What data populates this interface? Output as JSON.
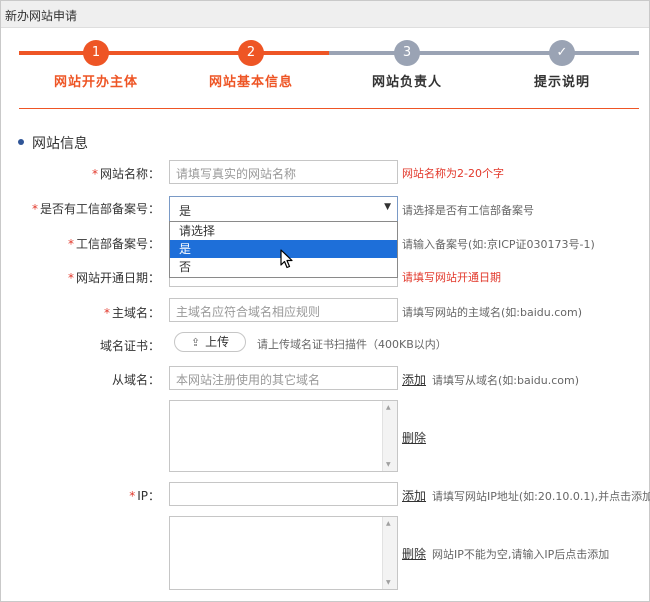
{
  "window": {
    "title": "新办网站申请"
  },
  "steps": [
    {
      "number": "1",
      "label": "网站开办主体",
      "state": "done"
    },
    {
      "number": "2",
      "label": "网站基本信息",
      "state": "active"
    },
    {
      "number": "3",
      "label": "网站负责人",
      "state": "pending"
    },
    {
      "number": "✓",
      "label": "提示说明",
      "state": "pending"
    }
  ],
  "section": {
    "title": "网站信息"
  },
  "form": {
    "site_name": {
      "required": "*",
      "label": "网站名称：",
      "placeholder": "请填写真实的网站名称",
      "hint": "网站名称为2-20个字"
    },
    "icp_filed": {
      "required": "*",
      "label": "是否有工信部备案号：",
      "value": "是",
      "hint": "请选择是否有工信部备案号",
      "options": [
        "请选择",
        "是",
        "否"
      ],
      "highlighted": "是"
    },
    "icp_number": {
      "required": "*",
      "label": "工信部备案号：",
      "hint": "请输入备案号(如:京ICP证030173号-1)"
    },
    "open_date": {
      "required": "*",
      "label": "网站开通日期：",
      "hint": "请填写网站开通日期"
    },
    "main_domain": {
      "required": "*",
      "label": "主域名：",
      "placeholder": "主域名应符合域名相应规则",
      "hint": "请填写网站的主域名(如:baidu.com)"
    },
    "domain_cert": {
      "label": "域名证书：",
      "upload_label": "上传",
      "hint": "请上传域名证书扫描件（400KB以内）"
    },
    "sub_domain": {
      "label": "从域名：",
      "placeholder": "本网站注册使用的其它域名",
      "add_label": "添加",
      "hint": "请填写从域名(如:baidu.com)",
      "delete_label": "删除"
    },
    "ip": {
      "required": "*",
      "label": "IP：",
      "add_label": "添加",
      "hint": "请填写网站IP地址(如:20.10.0.1),并点击添加",
      "delete_label": "删除",
      "delete_hint": "网站IP不能为空,请输入IP后点击添加"
    }
  },
  "colors": {
    "accent": "#ee5525",
    "pending": "#9aa3b4",
    "error": "#e2382b",
    "selection": "#1e6fd9"
  },
  "icons": {
    "upload": "upload-icon",
    "caret": "caret-down-icon",
    "check": "check-icon",
    "cursor": "mouse-pointer-icon"
  }
}
